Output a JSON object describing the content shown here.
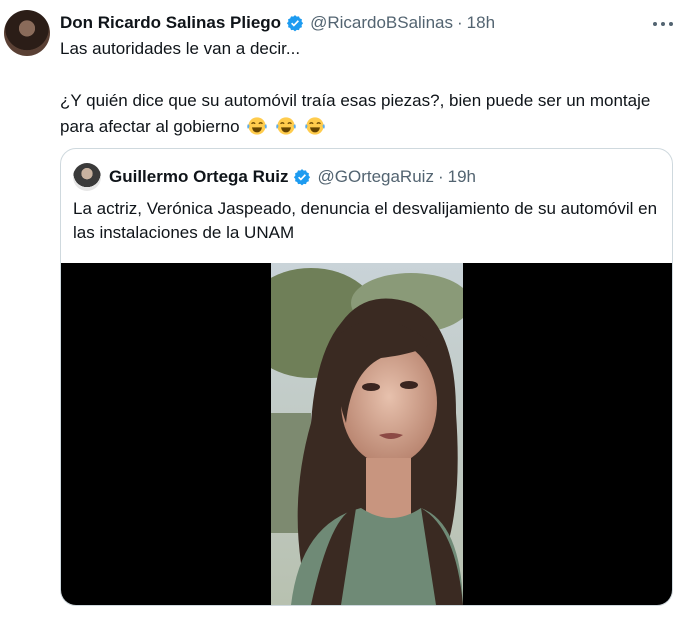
{
  "tweet": {
    "name": "Don Ricardo Salinas Pliego",
    "handle": "@RicardoBSalinas",
    "separator": "·",
    "time": "18h",
    "line1": "Las autoridades le van a decir...",
    "line2": "¿Y quién dice que su automóvil traía esas piezas?, bien puede ser un montaje para afectar al gobierno",
    "emojis": [
      "laughing-with-tears-emoji",
      "laughing-with-tears-emoji",
      "laughing-with-tears-emoji"
    ]
  },
  "quoted": {
    "name": "Guillermo Ortega Ruiz",
    "handle": "@GOrtegaRuiz",
    "separator": "·",
    "time": "19h",
    "text": "La actriz, Verónica Jaspeado, denuncia el desvalijamiento de su automóvil en las instalaciones de la UNAM"
  },
  "icons": {
    "verified": "verified-badge-icon",
    "more": "more-options-icon"
  },
  "colors": {
    "verified": "#1d9bf0",
    "secondary_text": "#536471",
    "border": "#cfd9de",
    "video_bg": "#000000"
  }
}
